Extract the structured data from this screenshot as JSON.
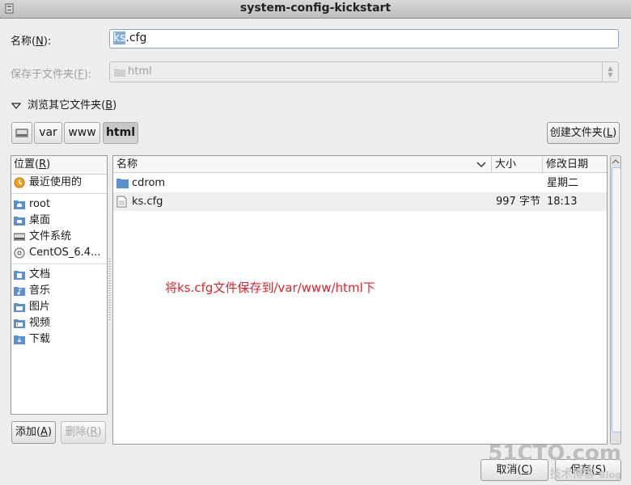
{
  "window": {
    "title": "system-config-kickstart"
  },
  "name_row": {
    "label_pre": "名称(",
    "label_key": "N",
    "label_post": "):",
    "value_selected": "ks",
    "value_rest": ".cfg"
  },
  "save_in_row": {
    "label_pre": "保存于文件夹(",
    "label_key": "F",
    "label_post": "):",
    "value": "html"
  },
  "browse": {
    "label_pre": "浏览其它文件夹(",
    "label_key": "B",
    "label_post": ")"
  },
  "pathbar": {
    "items": [
      "var",
      "www",
      "html"
    ],
    "active": "html"
  },
  "create_folder": {
    "label_pre": "创建文件夹(",
    "label_key": "L",
    "label_post": ")"
  },
  "places": {
    "header_pre": "位置(",
    "header_key": "R",
    "header_post": ")",
    "items": [
      {
        "label": "最近使用的",
        "icon": "recent-icon"
      },
      {
        "label": "root",
        "icon": "home-folder-icon"
      },
      {
        "label": "桌面",
        "icon": "desktop-folder-icon"
      },
      {
        "label": "文件系统",
        "icon": "drive-icon"
      },
      {
        "label": "CentOS_6.4...",
        "icon": "disc-icon"
      },
      {
        "label": "文档",
        "icon": "documents-folder-icon"
      },
      {
        "label": "音乐",
        "icon": "music-folder-icon"
      },
      {
        "label": "图片",
        "icon": "pictures-folder-icon"
      },
      {
        "label": "视频",
        "icon": "videos-folder-icon"
      },
      {
        "label": "下载",
        "icon": "downloads-folder-icon"
      }
    ],
    "add_pre": "添加(",
    "add_key": "A",
    "add_post": ")",
    "remove_pre": "删除(",
    "remove_key": "R",
    "remove_post": ")"
  },
  "files": {
    "columns": {
      "name": "名称",
      "size": "大小",
      "modified": "修改日期"
    },
    "rows": [
      {
        "name": "cdrom",
        "size": "",
        "modified": "星期二",
        "icon": "folder-icon"
      },
      {
        "name": "ks.cfg",
        "size": "997 字节",
        "modified": "18:13",
        "icon": "file-icon"
      }
    ]
  },
  "annotation": "将ks.cfg文件保存到/var/www/html下",
  "buttons": {
    "cancel_pre": "取消(",
    "cancel_key": "C",
    "cancel_post": ")",
    "save_pre": "保存(",
    "save_key": "S",
    "save_post": ")"
  },
  "watermark": {
    "brand": "51CTO.com",
    "sub": "技术博客",
    "blog": "Blog"
  },
  "colors": {
    "selection": "#86abd9",
    "annotation": "#e0222a",
    "folder": "#5b8fce"
  }
}
